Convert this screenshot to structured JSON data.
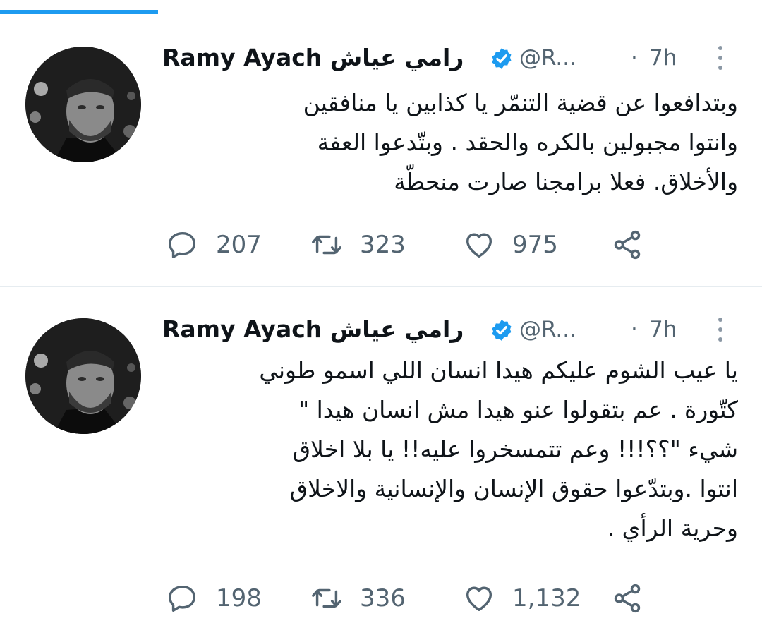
{
  "tweets": [
    {
      "display_name": "Ramy Ayach رامي عياش",
      "handle": "@R...",
      "separator": "·",
      "time": "7h",
      "text": "وبتدافعوا عن قضية التنمّر يا كذابين يا منافقين\nوانتوا مجبولين بالكره والحقد . وبتّدعوا العفة\nوالأخلاق.  فعلا برامجنا صارت منحطّة",
      "replies": "207",
      "retweets": "323",
      "likes": "975"
    },
    {
      "display_name": "Ramy Ayach رامي عياش",
      "handle": "@R...",
      "separator": "·",
      "time": "7h",
      "text": "يا عيب الشوم عليكم هيدا انسان اللي اسمو  طوني\nكتّورة . عم بتقولوا عنو هيدا مش انسان  هيدا \"\nشيء \"؟؟!!! وعم تتمسخروا  عليه!! يا بلا اخلاق\nانتوا .وبتدّعوا حقوق الإنسان والإنسانية والاخلاق\nوحرية الرأي .",
      "replies": "198",
      "retweets": "336",
      "likes": "1,132"
    }
  ],
  "icons": {
    "verified": "verified-badge-icon",
    "more": "more-vertical-icon",
    "reply": "reply-bubble-icon",
    "retweet": "retweet-icon",
    "like": "heart-icon",
    "share": "share-icon"
  },
  "colors": {
    "accent": "#1d9bf0",
    "text": "#0f1419",
    "secondary": "#536471",
    "divider": "#e6ecf0"
  }
}
